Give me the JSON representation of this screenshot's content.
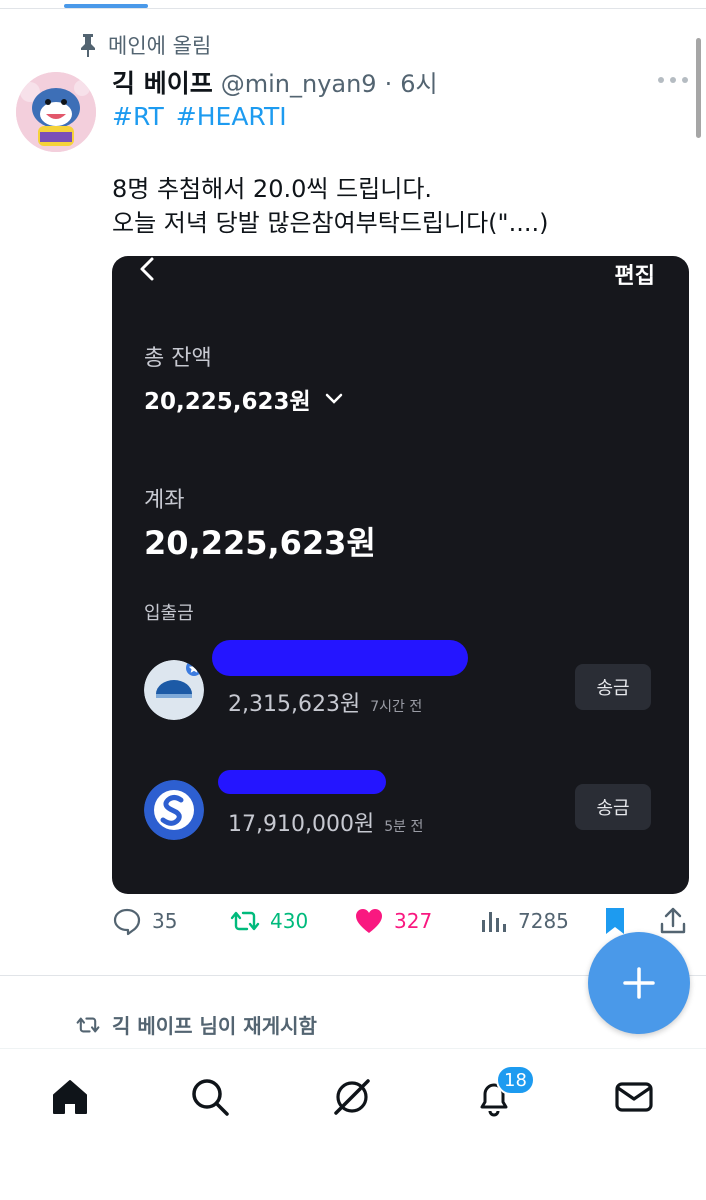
{
  "pinned": {
    "label": "메인에 올림"
  },
  "tweet": {
    "display_name": "긱 베이프",
    "handle": "@min_nyan9",
    "separator": "·",
    "time": "6시",
    "hashtags": [
      "#RT",
      "#HEARTI"
    ],
    "text_lines": [
      "8명 추첨해서 20.0씩 드립니다.",
      "오늘 저녁 당발 많은참여부탁드립니다(\"....)"
    ]
  },
  "media": {
    "edit_label": "편집",
    "total_label": "총 잔액",
    "total_amount": "20,225,623원",
    "account_label": "계좌",
    "account_amount": "20,225,623원",
    "io_label": "입출금",
    "transactions": [
      {
        "amount": "2,315,623원",
        "time": "7시간 전",
        "button": "송금"
      },
      {
        "amount": "17,910,000원",
        "time": "5분 전",
        "button": "송금"
      }
    ]
  },
  "actions": {
    "replies": "35",
    "retweets": "430",
    "likes": "327",
    "views": "7285"
  },
  "retweet_notice": "긱 베이프 님이 재게시함",
  "bottom_nav": {
    "notifications_badge": "18"
  },
  "colors": {
    "accent": "#1d9bf0",
    "fab": "#4a99e9",
    "retweet": "#00ba7c",
    "like": "#f91880",
    "media_bg": "#16171c",
    "redaction": "#2415ff"
  },
  "icons": [
    "pin-icon",
    "more-icon",
    "back-icon",
    "chevron-down-icon",
    "reply-icon",
    "retweet-icon",
    "heart-icon",
    "views-icon",
    "bookmark-icon",
    "share-icon",
    "plus-icon",
    "home-icon",
    "search-icon",
    "grok-icon",
    "bell-icon",
    "mail-icon"
  ]
}
